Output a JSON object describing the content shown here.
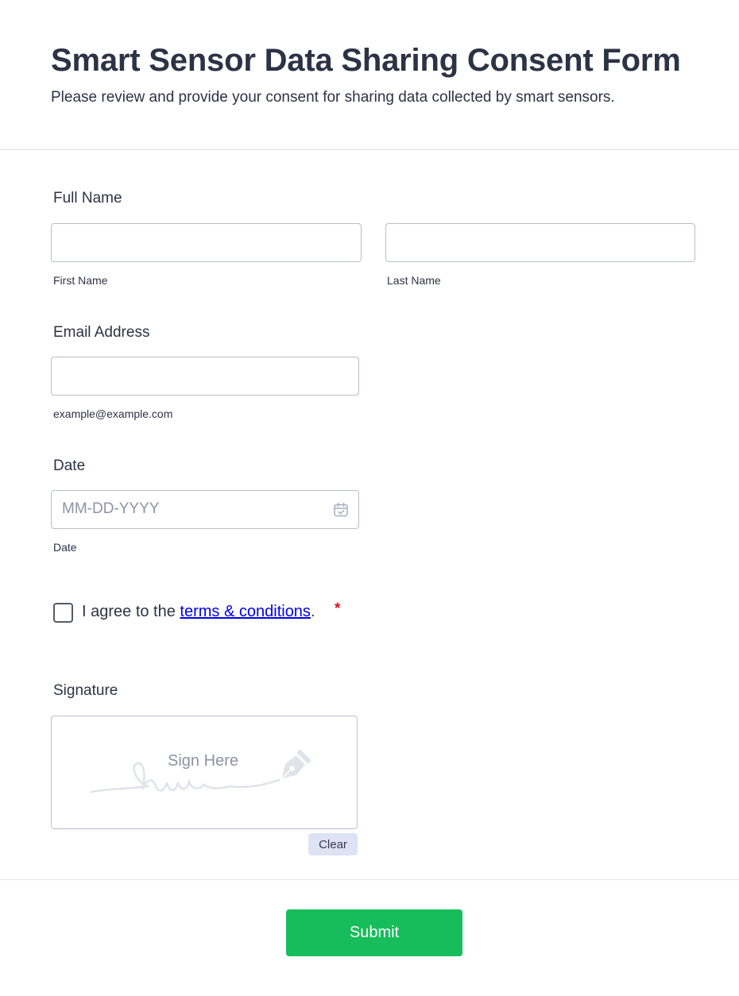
{
  "form": {
    "title": "Smart Sensor Data Sharing Consent Form",
    "subtitle": "Please review and provide your consent for sharing data collected by smart sensors."
  },
  "full_name": {
    "label": "Full Name",
    "first_value": "",
    "first_sublabel": "First Name",
    "last_value": "",
    "last_sublabel": "Last Name"
  },
  "email": {
    "label": "Email Address",
    "value": "",
    "sublabel": "example@example.com"
  },
  "date": {
    "label": "Date",
    "placeholder": "MM-DD-YYYY",
    "sublabel": "Date",
    "icon": "calendar-icon"
  },
  "terms": {
    "checked": false,
    "prefix": "I agree to the ",
    "link_text": "terms & conditions",
    "suffix": ".",
    "required_mark": "*"
  },
  "signature": {
    "label": "Signature",
    "pad_text": "Sign Here",
    "icon": "pen-nib-icon",
    "clear_label": "Clear"
  },
  "submit": {
    "label": "Submit",
    "color": "#18bd5b"
  }
}
